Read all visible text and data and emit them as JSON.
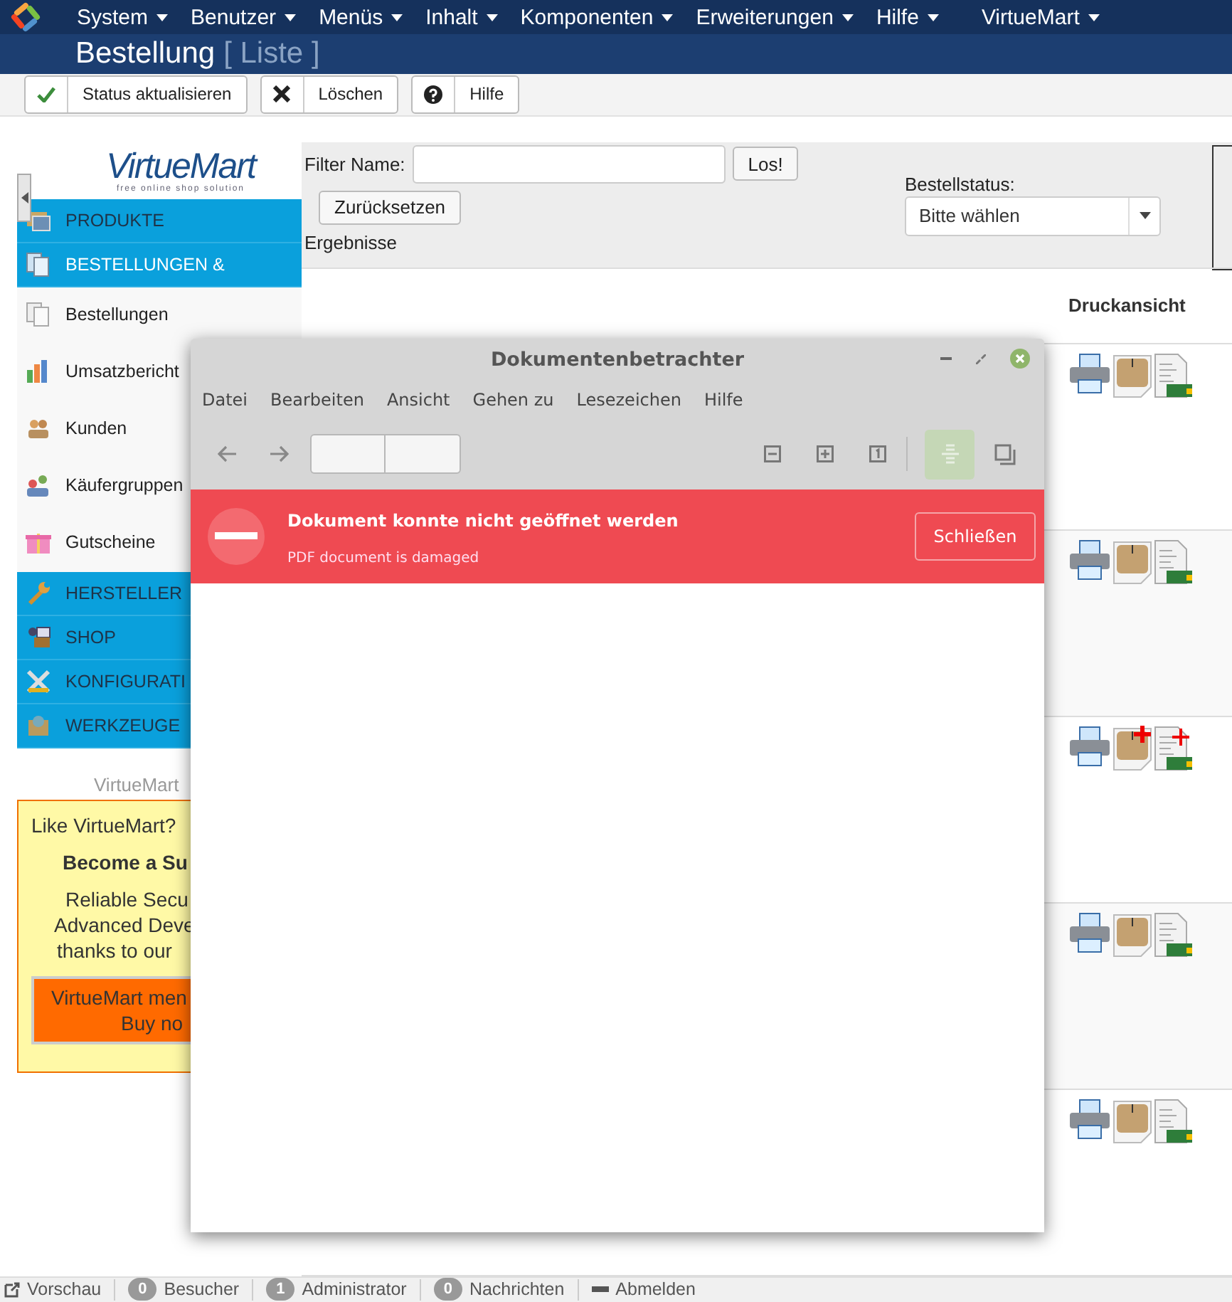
{
  "top_menu": [
    {
      "label": "System"
    },
    {
      "label": "Benutzer"
    },
    {
      "label": "Menüs"
    },
    {
      "label": "Inhalt"
    },
    {
      "label": "Komponenten"
    },
    {
      "label": "Erweiterungen"
    },
    {
      "label": "Hilfe"
    },
    {
      "label": "VirtueMart"
    }
  ],
  "page_title": {
    "title": "Bestellung",
    "subtitle": "[ Liste ]"
  },
  "toolbar": [
    {
      "kind": "check",
      "label": "Status aktualisieren"
    },
    {
      "kind": "delete",
      "label": "Löschen"
    },
    {
      "kind": "help",
      "label": "Hilfe"
    }
  ],
  "sidebar": {
    "logo": "VirtueMart",
    "tagline": "free online shop solution",
    "items": [
      {
        "kind": "section",
        "label": "PRODUKTE",
        "selected": false
      },
      {
        "kind": "section",
        "label": "BESTELLUNGEN &",
        "selected": true
      },
      {
        "kind": "item",
        "label": "Bestellungen"
      },
      {
        "kind": "item",
        "label": "Umsatzbericht"
      },
      {
        "kind": "item",
        "label": "Kunden"
      },
      {
        "kind": "item",
        "label": "Käufergruppen"
      },
      {
        "kind": "item",
        "label": "Gutscheine"
      },
      {
        "kind": "section",
        "label": "HERSTELLER",
        "selected": false
      },
      {
        "kind": "section",
        "label": "SHOP",
        "selected": false
      },
      {
        "kind": "section",
        "label": "KONFIGURATI",
        "selected": false
      },
      {
        "kind": "section",
        "label": "WERKZEUGE",
        "selected": false
      }
    ],
    "version": "VirtueMart",
    "promo": {
      "intro": "Like VirtueMart?",
      "heading": "Become a Su",
      "lines": [
        "Reliable Secu",
        "Advanced Deve",
        "thanks to our"
      ],
      "button": [
        "VirtueMart men",
        "Buy no"
      ]
    }
  },
  "filter": {
    "name_label": "Filter Name:",
    "go_button": "Los!",
    "reset_button": "Zurücksetzen",
    "results_label": "Ergebnisse",
    "status_label": "Bestellstatus:",
    "status_value": "Bitte wählen"
  },
  "table": {
    "columns": [
      "Druckansicht"
    ],
    "rows": [
      {
        "marked_new": false
      },
      {
        "marked_new": false
      },
      {
        "marked_new": true
      },
      {
        "marked_new": false
      },
      {
        "marked_new": false
      }
    ]
  },
  "status_bar": [
    {
      "kind": "link",
      "label": "Vorschau"
    },
    {
      "kind": "count",
      "count": "0",
      "label": "Besucher"
    },
    {
      "kind": "count",
      "count": "1",
      "label": "Administrator"
    },
    {
      "kind": "count",
      "count": "0",
      "label": "Nachrichten"
    },
    {
      "kind": "logout",
      "label": "Abmelden"
    }
  ],
  "viewer": {
    "title": "Dokumentenbetrachter",
    "menu": [
      "Datei",
      "Bearbeiten",
      "Ansicht",
      "Gehen zu",
      "Lesezeichen",
      "Hilfe"
    ],
    "continuous_view_on": true,
    "error": {
      "title": "Dokument konnte nicht geöffnet werden",
      "detail": "PDF document is damaged",
      "button": "Schließen"
    }
  }
}
